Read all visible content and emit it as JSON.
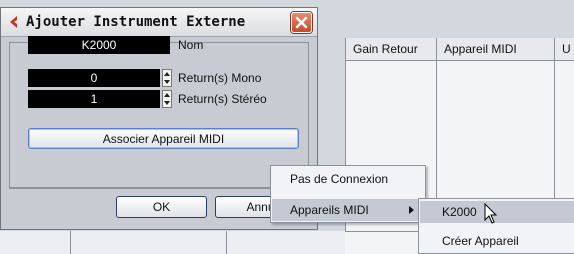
{
  "table": {
    "columns": [
      "Gain Retour",
      "Appareil MIDI",
      "U"
    ]
  },
  "dialog": {
    "title": "Ajouter Instrument Externe",
    "name_value": "K2000",
    "name_label": "Nom",
    "mono_value": "0",
    "mono_label": "Return(s) Mono",
    "stereo_value": "1",
    "stereo_label": "Return(s) Stéréo",
    "assoc_button": "Associer Appareil MIDI",
    "ok_button": "OK",
    "cancel_button": "Annu"
  },
  "menu": {
    "items": [
      "Pas de Connexion",
      "Appareils MIDI"
    ]
  },
  "submenu": {
    "items": [
      "K2000",
      "Créer Appareil"
    ]
  },
  "colors": {
    "title_icon": "#c8342a",
    "close_button": "#d05a3a",
    "selection": "#c5c9d3"
  }
}
